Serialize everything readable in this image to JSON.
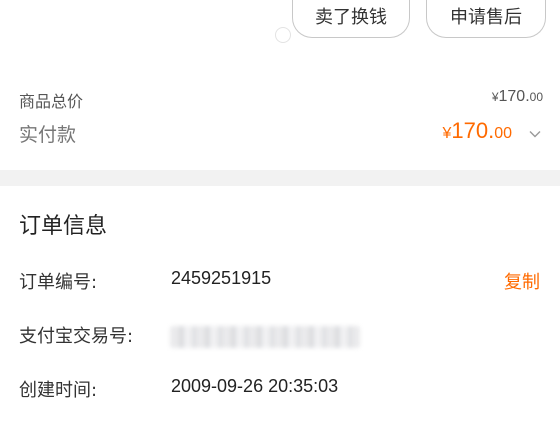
{
  "actions": {
    "sell_label": "卖了换钱",
    "aftersale_label": "申请售后"
  },
  "summary": {
    "goods_total_label": "商品总价",
    "goods_total_currency": "¥",
    "goods_total_int": "170.",
    "goods_total_cents": "00",
    "paid_label": "实付款",
    "paid_currency": "¥",
    "paid_int": "170.",
    "paid_cents": "00",
    "expand_icon": "chevron-down-icon"
  },
  "order_info": {
    "title": "订单信息",
    "order_number_label": "订单编号:",
    "order_number": "2459251915",
    "copy_label": "复制",
    "alipay_label": "支付宝交易号:",
    "alipay_value": "",
    "created_label": "创建时间:",
    "created_value": "2009-09-26 20:35:03"
  },
  "colors": {
    "accent": "#ff6a00",
    "separator": "#f2f2f2"
  }
}
